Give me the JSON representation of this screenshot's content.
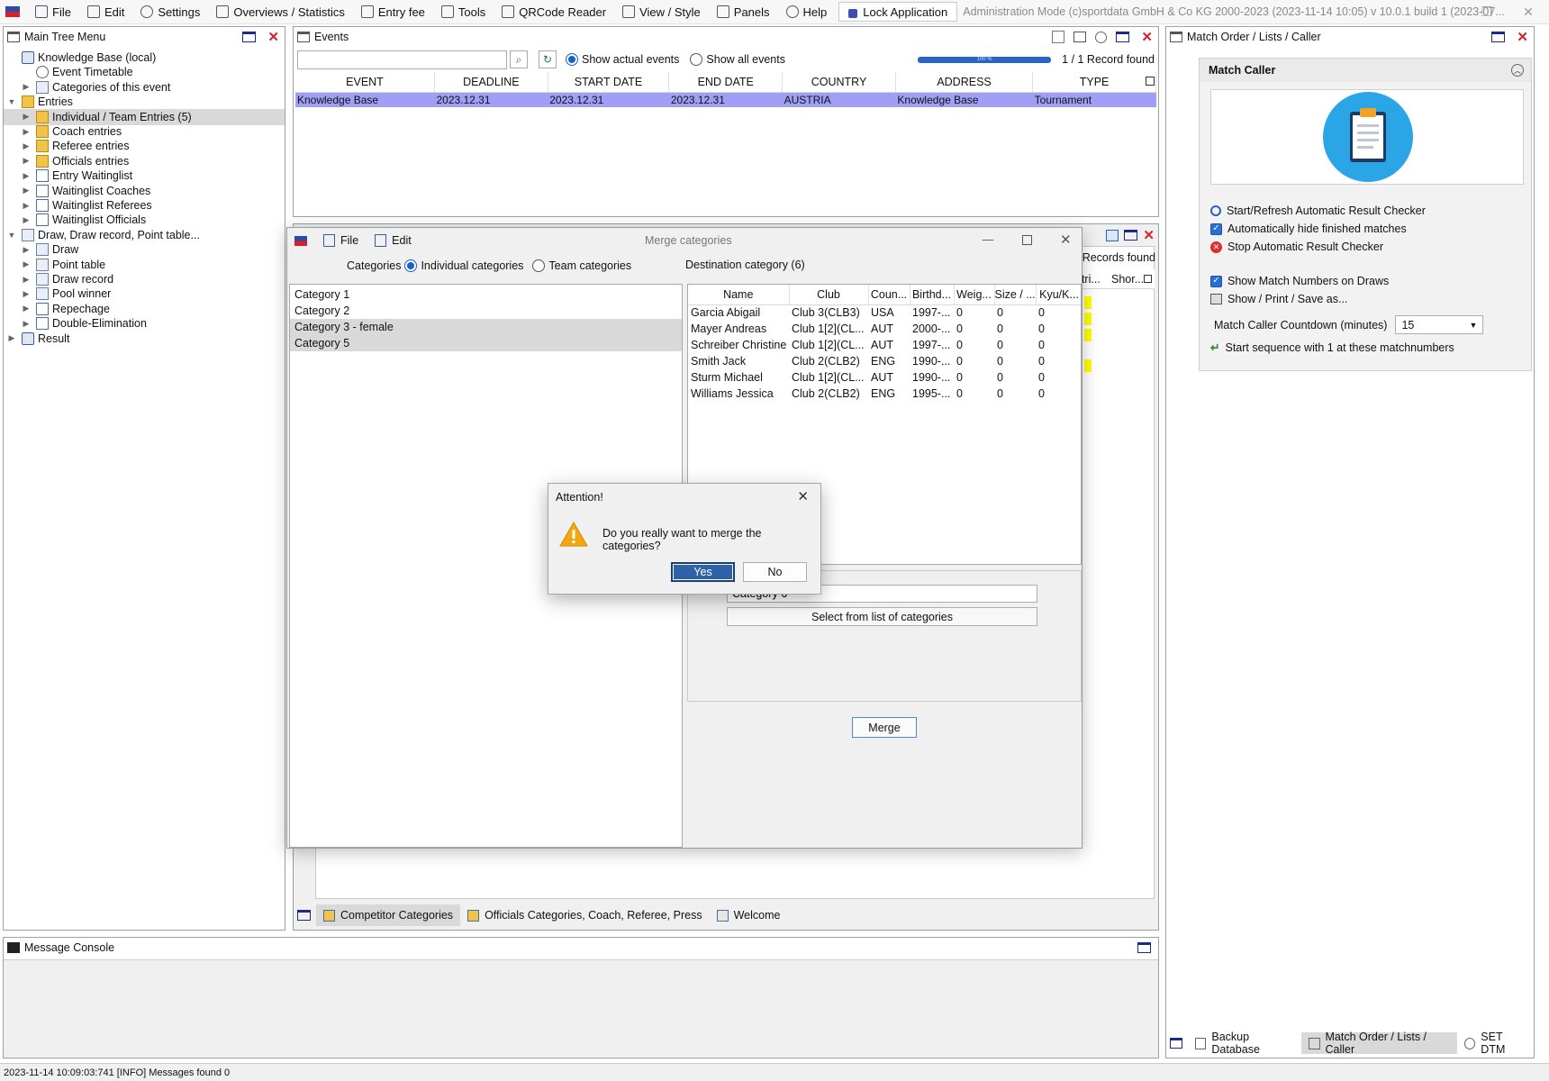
{
  "menubar": {
    "items": [
      {
        "label": "File",
        "icon": "file-icon"
      },
      {
        "label": "Edit",
        "icon": "edit-icon"
      },
      {
        "label": "Settings",
        "icon": "gear-icon"
      },
      {
        "label": "Overviews / Statistics",
        "icon": "overview-icon"
      },
      {
        "label": "Entry fee",
        "icon": "money-icon"
      },
      {
        "label": "Tools",
        "icon": "wrench-icon"
      },
      {
        "label": "QRCode Reader",
        "icon": "qrcode-icon"
      },
      {
        "label": "View / Style",
        "icon": "view-icon"
      },
      {
        "label": "Panels",
        "icon": "panels-icon"
      },
      {
        "label": "Help",
        "icon": "help-icon"
      }
    ],
    "lock_label": "Lock Application",
    "admin_text": "Administration Mode (c)sportdata GmbH & Co KG 2000-2023 (2023-11-14 10:05)  v 10.0.1 build 1 (2023-07..."
  },
  "tree": {
    "title": "Main Tree Menu",
    "items": [
      {
        "label": "Knowledge Base (local)",
        "level": 0,
        "toggle": "",
        "icon": "database-icon"
      },
      {
        "label": "Event Timetable",
        "level": 1,
        "toggle": "",
        "icon": "clock-icon"
      },
      {
        "label": "Categories of this event",
        "level": 1,
        "toggle": "▶",
        "icon": "grid-icon"
      },
      {
        "label": "Entries",
        "level": 0,
        "toggle": "▼",
        "icon": "folder-icon"
      },
      {
        "label": "Individual / Team Entries (5)",
        "level": 1,
        "toggle": "▶",
        "icon": "folder-icon",
        "selected": true
      },
      {
        "label": "Coach entries",
        "level": 1,
        "toggle": "▶",
        "icon": "folder-icon"
      },
      {
        "label": "Referee entries",
        "level": 1,
        "toggle": "▶",
        "icon": "folder-icon"
      },
      {
        "label": "Officials entries",
        "level": 1,
        "toggle": "▶",
        "icon": "folder-icon"
      },
      {
        "label": "Entry Waitinglist",
        "level": 1,
        "toggle": "▶",
        "icon": "doc-icon"
      },
      {
        "label": "Waitinglist Coaches",
        "level": 1,
        "toggle": "▶",
        "icon": "doc-icon"
      },
      {
        "label": "Waitinglist Referees",
        "level": 1,
        "toggle": "▶",
        "icon": "doc-icon"
      },
      {
        "label": "Waitinglist Officials",
        "level": 1,
        "toggle": "▶",
        "icon": "doc-icon"
      },
      {
        "label": "Draw, Draw record, Point table...",
        "level": 0,
        "toggle": "▼",
        "icon": "list-icon"
      },
      {
        "label": "Draw",
        "level": 1,
        "toggle": "▶",
        "icon": "list-icon"
      },
      {
        "label": "Point table",
        "level": 1,
        "toggle": "▶",
        "icon": "list-icon"
      },
      {
        "label": "Draw record",
        "level": 1,
        "toggle": "▶",
        "icon": "grid-icon"
      },
      {
        "label": "Pool winner",
        "level": 1,
        "toggle": "▶",
        "icon": "grid-icon"
      },
      {
        "label": "Repechage",
        "level": 1,
        "toggle": "▶",
        "icon": "doc-icon"
      },
      {
        "label": "Double-Elimination",
        "level": 1,
        "toggle": "▶",
        "icon": "doc-icon"
      },
      {
        "label": "Result",
        "level": 0,
        "toggle": "▶",
        "icon": "database-icon"
      }
    ]
  },
  "events": {
    "title": "Events",
    "search_value": "",
    "radio_actual": "Show actual events",
    "radio_all": "Show all events",
    "progress_label": "100 %",
    "records": "1 / 1 Record found",
    "columns": [
      "EVENT",
      "DEADLINE",
      "START DATE",
      "END DATE",
      "COUNTRY",
      "ADDRESS",
      "TYPE"
    ],
    "rows": [
      [
        "Knowledge Base",
        "2023.12.31",
        "2023.12.31",
        "2023.12.31",
        "AUSTRIA",
        "Knowledge Base",
        "Tournament"
      ]
    ]
  },
  "behind": {
    "records": "5 Records found",
    "col1": "ntri...",
    "col2": "Shor..."
  },
  "merge": {
    "title": "Merge categories",
    "menu_file": "File",
    "menu_edit": "Edit",
    "categories_label": "Categories",
    "radio_individual": "Individual categories",
    "radio_team": "Team categories",
    "destination_label": "Destination category (6)",
    "categories": [
      {
        "label": "Category 1",
        "selected": false
      },
      {
        "label": "Category 2",
        "selected": false
      },
      {
        "label": "Category 3 - female",
        "selected": true
      },
      {
        "label": "Category 5",
        "selected": true
      }
    ],
    "columns": [
      "Name",
      "Club",
      "Coun...",
      "Birthd...",
      "Weig...",
      "Size / ...",
      "Kyu/K..."
    ],
    "rows": [
      [
        "Garcia Abigail",
        "Club 3(CLB3)",
        "USA",
        "1997-...",
        "0",
        "0",
        "0"
      ],
      [
        "Mayer Andreas",
        "Club 1[2](CL...",
        "AUT",
        "2000-...",
        "0",
        "0",
        "0"
      ],
      [
        "Schreiber Christine",
        "Club 1[2](CL...",
        "AUT",
        "1997-...",
        "0",
        "0",
        "0"
      ],
      [
        "Smith Jack",
        "Club 2(CLB2)",
        "ENG",
        "1990-...",
        "0",
        "0",
        "0"
      ],
      [
        "Sturm Michael",
        "Club 1[2](CL...",
        "AUT",
        "1990-...",
        "0",
        "0",
        "0"
      ],
      [
        "Williams Jessica",
        "Club 2(CLB2)",
        "ENG",
        "1995-...",
        "0",
        "0",
        "0"
      ]
    ],
    "dest_value": "Category 6",
    "select_button": "Select from list of categories",
    "merge_button": "Merge"
  },
  "attention": {
    "title": "Attention!",
    "message": "Do you really want to merge the categories?",
    "yes": "Yes",
    "no": "No"
  },
  "center_tabs": [
    "Competitor Categories",
    "Officials Categories, Coach, Referee, Press",
    "Welcome"
  ],
  "console": {
    "title": "Message Console"
  },
  "status": "2023-11-14 10:09:03:741 [INFO] Messages found 0",
  "right": {
    "title": "Match Order / Lists / Caller",
    "section": "Match Caller",
    "items": [
      {
        "label": "Start/Refresh Automatic Result Checker",
        "icon": "search-icon"
      },
      {
        "label": "Automatically hide finished matches",
        "icon": "checkbox-checked"
      },
      {
        "label": "Stop Automatic Result Checker",
        "icon": "stop-icon"
      },
      {
        "label": "Show Match Numbers on Draws",
        "icon": "checkbox-checked"
      },
      {
        "label": "Show / Print / Save as...",
        "icon": "print-icon"
      }
    ],
    "countdown_label": "Match Caller Countdown (minutes)",
    "countdown_value": "15",
    "sequence_label": "Start sequence with 1 at these matchnumbers",
    "tabs": [
      "Backup Database",
      "Match Order / Lists / Caller",
      "SET DTM"
    ]
  }
}
